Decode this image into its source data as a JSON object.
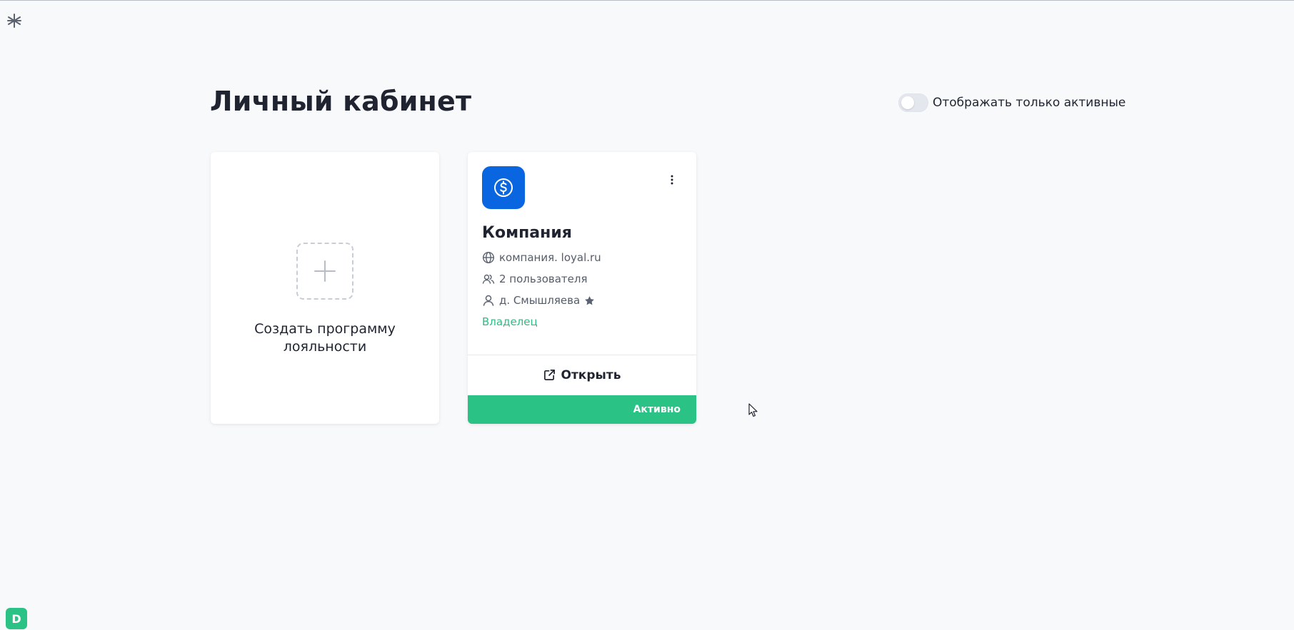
{
  "app": {
    "logo_icon": "asterisk-logo-icon",
    "avatar_letter": "D",
    "avatar_color": "#2bc286"
  },
  "header": {
    "title": "Личный кабинет",
    "filter_toggle": {
      "label": "Отображать только активные",
      "checked": false
    }
  },
  "create_card": {
    "label": "Создать программу лояльности",
    "icon": "plus-icon"
  },
  "programs": [
    {
      "name": "Компания",
      "logo_icon": "dollar-circle-icon",
      "logo_color": "#0a66e0",
      "domain": "компания. loyal.ru",
      "users": "2 пользователя",
      "owner": "д. Смышляева",
      "role": "Владелец",
      "open_label": "Открыть",
      "status": "Активно",
      "status_color": "#2bc286"
    }
  ]
}
